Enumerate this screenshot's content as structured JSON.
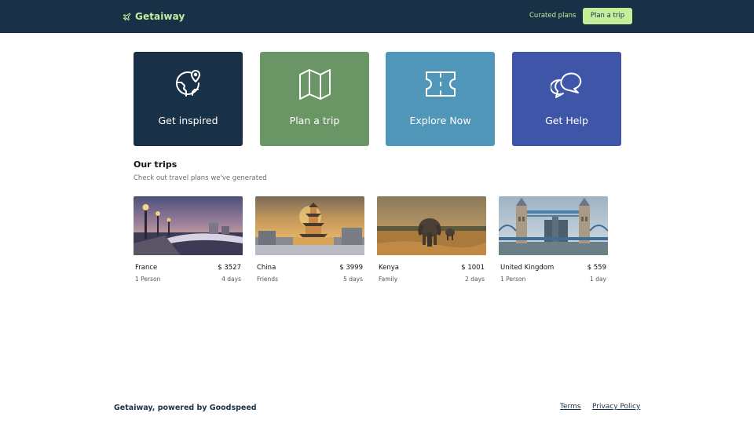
{
  "header": {
    "brand": "Getaiway",
    "brand_icon": "plane-icon",
    "nav_link": "Curated plans",
    "cta": "Plan a trip"
  },
  "colors": {
    "navy": "#193147",
    "accent_green": "#c4ee9b",
    "card_green": "#6a9665",
    "card_teal": "#5096b8",
    "card_indigo": "#3f56a8"
  },
  "action_cards": [
    {
      "label": "Get inspired",
      "icon": "globe-pin-icon"
    },
    {
      "label": "Plan a trip",
      "icon": "map-icon"
    },
    {
      "label": "Explore Now",
      "icon": "ticket-icon"
    },
    {
      "label": "Get Help",
      "icon": "chat-bubbles-icon"
    }
  ],
  "trips_section": {
    "title": "Our trips",
    "subtitle": "Check out travel plans we've generated"
  },
  "trips": [
    {
      "country": "France",
      "price": "$ 3527",
      "group": "1 Person",
      "duration": "4 days",
      "photo": "paris-bridge-dusk-photo"
    },
    {
      "country": "China",
      "price": "$ 3999",
      "group": "Friends",
      "duration": "5 days",
      "photo": "pagoda-sunset-photo"
    },
    {
      "country": "Kenya",
      "price": "$ 1001",
      "group": "Family",
      "duration": "2 days",
      "photo": "elephant-savanna-photo"
    },
    {
      "country": "United Kingdom",
      "price": "$ 559",
      "group": "1 Person",
      "duration": "1 day",
      "photo": "tower-bridge-photo"
    }
  ],
  "footer": {
    "brand": "Getaiway, powered by Goodspeed",
    "terms": "Terms",
    "privacy": "Privacy Policy"
  }
}
